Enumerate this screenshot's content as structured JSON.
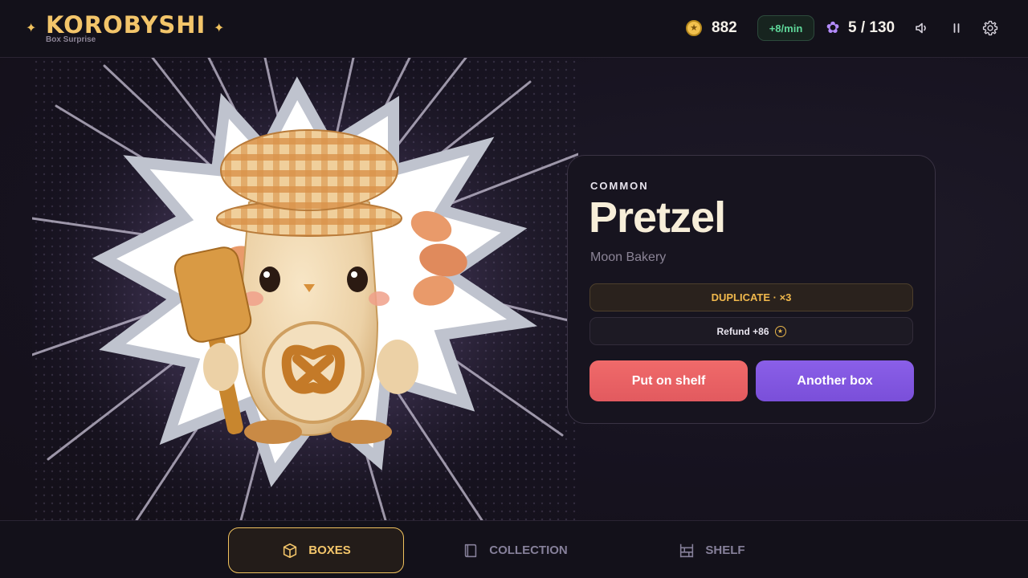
{
  "app": {
    "title": "KOROBYSHI",
    "subtitle": "Box Surprise"
  },
  "hud": {
    "coins": "882",
    "rate": "+8/min",
    "collected": "5 / 130",
    "icons": [
      "coin-icon",
      "flower-icon",
      "speaker-icon",
      "pause-icon",
      "gear-icon"
    ]
  },
  "reveal": {
    "rarity": "COMMON",
    "name": "Pretzel",
    "series": "Moon Bakery",
    "duplicate": "DUPLICATE · ×3",
    "refund": "Refund +86",
    "actions": {
      "shelf": "Put on shelf",
      "another": "Another box"
    }
  },
  "nav": {
    "tabs": [
      {
        "label": "BOXES",
        "icon": "box-icon",
        "active": true
      },
      {
        "label": "COLLECTION",
        "icon": "book-icon",
        "active": false
      },
      {
        "label": "SHELF",
        "icon": "shelf-icon",
        "active": false
      }
    ]
  },
  "colors": {
    "accent_gold": "#f3c56a",
    "shelf_button": "#e25a5f",
    "another_button": "#7a4fd9",
    "rate_green": "#5fd89a",
    "collection_purple": "#b48cff"
  }
}
